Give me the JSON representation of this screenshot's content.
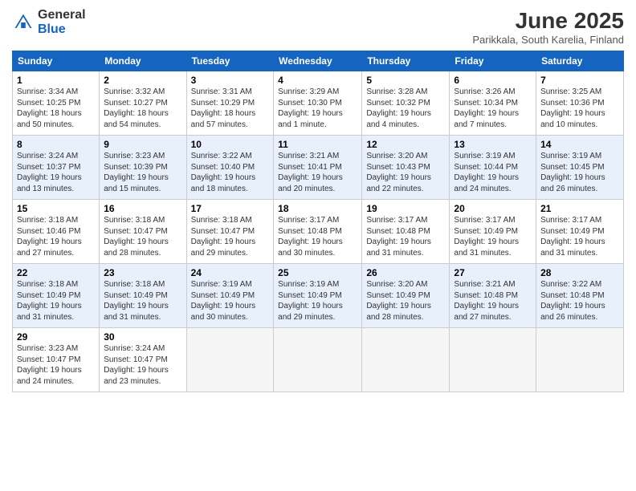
{
  "header": {
    "logo_general": "General",
    "logo_blue": "Blue",
    "month_title": "June 2025",
    "location": "Parikkala, South Karelia, Finland"
  },
  "days_of_week": [
    "Sunday",
    "Monday",
    "Tuesday",
    "Wednesday",
    "Thursday",
    "Friday",
    "Saturday"
  ],
  "weeks": [
    [
      {
        "num": "1",
        "sunrise": "Sunrise: 3:34 AM",
        "sunset": "Sunset: 10:25 PM",
        "daylight": "Daylight: 18 hours and 50 minutes."
      },
      {
        "num": "2",
        "sunrise": "Sunrise: 3:32 AM",
        "sunset": "Sunset: 10:27 PM",
        "daylight": "Daylight: 18 hours and 54 minutes."
      },
      {
        "num": "3",
        "sunrise": "Sunrise: 3:31 AM",
        "sunset": "Sunset: 10:29 PM",
        "daylight": "Daylight: 18 hours and 57 minutes."
      },
      {
        "num": "4",
        "sunrise": "Sunrise: 3:29 AM",
        "sunset": "Sunset: 10:30 PM",
        "daylight": "Daylight: 19 hours and 1 minute."
      },
      {
        "num": "5",
        "sunrise": "Sunrise: 3:28 AM",
        "sunset": "Sunset: 10:32 PM",
        "daylight": "Daylight: 19 hours and 4 minutes."
      },
      {
        "num": "6",
        "sunrise": "Sunrise: 3:26 AM",
        "sunset": "Sunset: 10:34 PM",
        "daylight": "Daylight: 19 hours and 7 minutes."
      },
      {
        "num": "7",
        "sunrise": "Sunrise: 3:25 AM",
        "sunset": "Sunset: 10:36 PM",
        "daylight": "Daylight: 19 hours and 10 minutes."
      }
    ],
    [
      {
        "num": "8",
        "sunrise": "Sunrise: 3:24 AM",
        "sunset": "Sunset: 10:37 PM",
        "daylight": "Daylight: 19 hours and 13 minutes."
      },
      {
        "num": "9",
        "sunrise": "Sunrise: 3:23 AM",
        "sunset": "Sunset: 10:39 PM",
        "daylight": "Daylight: 19 hours and 15 minutes."
      },
      {
        "num": "10",
        "sunrise": "Sunrise: 3:22 AM",
        "sunset": "Sunset: 10:40 PM",
        "daylight": "Daylight: 19 hours and 18 minutes."
      },
      {
        "num": "11",
        "sunrise": "Sunrise: 3:21 AM",
        "sunset": "Sunset: 10:41 PM",
        "daylight": "Daylight: 19 hours and 20 minutes."
      },
      {
        "num": "12",
        "sunrise": "Sunrise: 3:20 AM",
        "sunset": "Sunset: 10:43 PM",
        "daylight": "Daylight: 19 hours and 22 minutes."
      },
      {
        "num": "13",
        "sunrise": "Sunrise: 3:19 AM",
        "sunset": "Sunset: 10:44 PM",
        "daylight": "Daylight: 19 hours and 24 minutes."
      },
      {
        "num": "14",
        "sunrise": "Sunrise: 3:19 AM",
        "sunset": "Sunset: 10:45 PM",
        "daylight": "Daylight: 19 hours and 26 minutes."
      }
    ],
    [
      {
        "num": "15",
        "sunrise": "Sunrise: 3:18 AM",
        "sunset": "Sunset: 10:46 PM",
        "daylight": "Daylight: 19 hours and 27 minutes."
      },
      {
        "num": "16",
        "sunrise": "Sunrise: 3:18 AM",
        "sunset": "Sunset: 10:47 PM",
        "daylight": "Daylight: 19 hours and 28 minutes."
      },
      {
        "num": "17",
        "sunrise": "Sunrise: 3:18 AM",
        "sunset": "Sunset: 10:47 PM",
        "daylight": "Daylight: 19 hours and 29 minutes."
      },
      {
        "num": "18",
        "sunrise": "Sunrise: 3:17 AM",
        "sunset": "Sunset: 10:48 PM",
        "daylight": "Daylight: 19 hours and 30 minutes."
      },
      {
        "num": "19",
        "sunrise": "Sunrise: 3:17 AM",
        "sunset": "Sunset: 10:48 PM",
        "daylight": "Daylight: 19 hours and 31 minutes."
      },
      {
        "num": "20",
        "sunrise": "Sunrise: 3:17 AM",
        "sunset": "Sunset: 10:49 PM",
        "daylight": "Daylight: 19 hours and 31 minutes."
      },
      {
        "num": "21",
        "sunrise": "Sunrise: 3:17 AM",
        "sunset": "Sunset: 10:49 PM",
        "daylight": "Daylight: 19 hours and 31 minutes."
      }
    ],
    [
      {
        "num": "22",
        "sunrise": "Sunrise: 3:18 AM",
        "sunset": "Sunset: 10:49 PM",
        "daylight": "Daylight: 19 hours and 31 minutes."
      },
      {
        "num": "23",
        "sunrise": "Sunrise: 3:18 AM",
        "sunset": "Sunset: 10:49 PM",
        "daylight": "Daylight: 19 hours and 31 minutes."
      },
      {
        "num": "24",
        "sunrise": "Sunrise: 3:19 AM",
        "sunset": "Sunset: 10:49 PM",
        "daylight": "Daylight: 19 hours and 30 minutes."
      },
      {
        "num": "25",
        "sunrise": "Sunrise: 3:19 AM",
        "sunset": "Sunset: 10:49 PM",
        "daylight": "Daylight: 19 hours and 29 minutes."
      },
      {
        "num": "26",
        "sunrise": "Sunrise: 3:20 AM",
        "sunset": "Sunset: 10:49 PM",
        "daylight": "Daylight: 19 hours and 28 minutes."
      },
      {
        "num": "27",
        "sunrise": "Sunrise: 3:21 AM",
        "sunset": "Sunset: 10:48 PM",
        "daylight": "Daylight: 19 hours and 27 minutes."
      },
      {
        "num": "28",
        "sunrise": "Sunrise: 3:22 AM",
        "sunset": "Sunset: 10:48 PM",
        "daylight": "Daylight: 19 hours and 26 minutes."
      }
    ],
    [
      {
        "num": "29",
        "sunrise": "Sunrise: 3:23 AM",
        "sunset": "Sunset: 10:47 PM",
        "daylight": "Daylight: 19 hours and 24 minutes."
      },
      {
        "num": "30",
        "sunrise": "Sunrise: 3:24 AM",
        "sunset": "Sunset: 10:47 PM",
        "daylight": "Daylight: 19 hours and 23 minutes."
      },
      null,
      null,
      null,
      null,
      null
    ]
  ]
}
